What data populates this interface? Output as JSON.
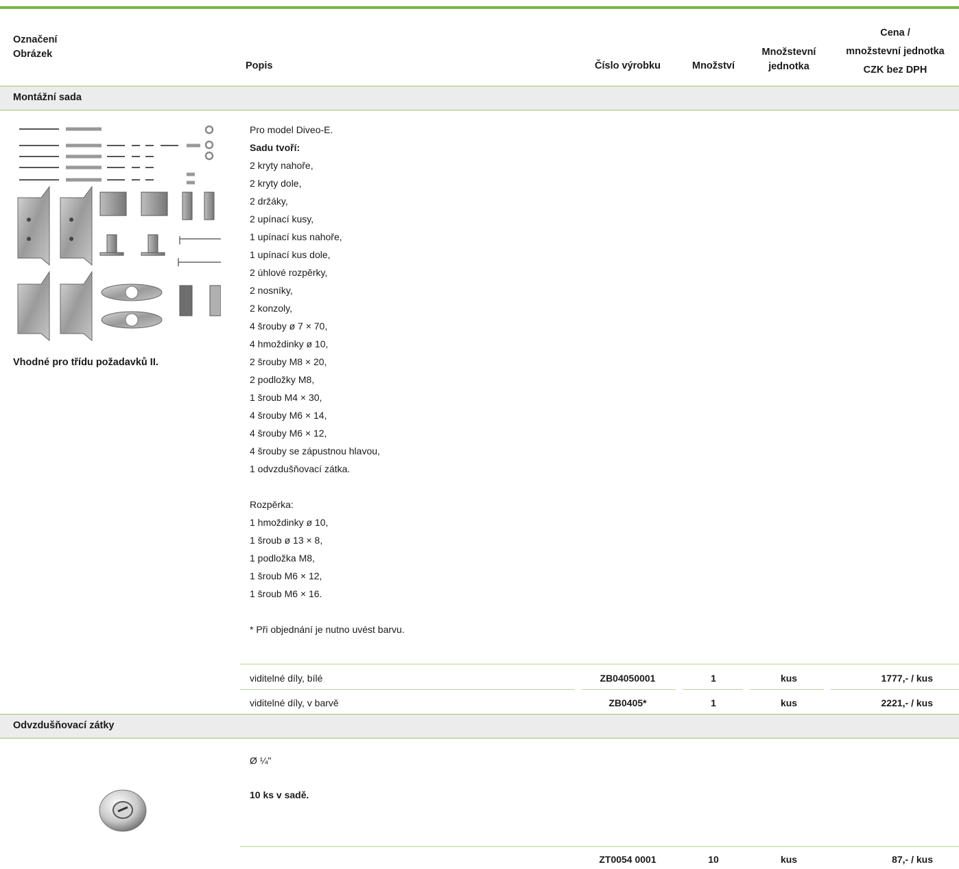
{
  "header": {
    "col1_line1": "Označení",
    "col1_line2": "Obrázek",
    "col2": "Popis",
    "col3": "Číslo výrobku",
    "col4": "Množství",
    "col5_line1": "Množstevní",
    "col5_line2": "jednotka",
    "col6_line1": "Cena /",
    "col6_line2": "množstevní jednotka",
    "col6_line3": "CZK bez DPH"
  },
  "sections": [
    {
      "title": "Montážní sada",
      "note": "Vhodné pro třídu požadavků II.",
      "desc_intro": "Pro model Diveo-E.",
      "desc_heading": "Sadu tvoří:",
      "items": [
        "2 kryty nahoře,",
        "2 kryty dole,",
        "2 držáky,",
        "2 upínací kusy,",
        "1 upínací kus nahoře,",
        "1 upínací kus dole,",
        "2 úhlové rozpěrky,",
        "2 nosníky,",
        "2 konzoly,",
        "4 šrouby ø 7 × 70,",
        "4 hmoždinky ø 10,",
        "2 šrouby M8 × 20,",
        "2 podložky M8,",
        "1 šroub M4 × 30,",
        "4 šrouby M6 × 14,",
        "4 šrouby M6 × 12,",
        "4 šrouby se zápustnou hlavou,",
        "1 odvzdušňovací zátka."
      ],
      "spacer_heading": "Rozpěrka:",
      "spacer_items": [
        "1 hmoždinky ø 10,",
        "1 šroub ø 13 × 8,",
        "1 podložka M8,",
        "1 šroub M6 × 12,",
        "1 šroub M6 × 16."
      ],
      "footnote": "* Při objednání je nutno uvést barvu.",
      "rows": [
        {
          "desc": "viditelné díly, bílé",
          "sku": "ZB04050001",
          "qty": "1",
          "unit": "kus",
          "price": "1777,- / kus"
        },
        {
          "desc": "viditelné díly, v barvě",
          "sku": "ZB0405*",
          "qty": "1",
          "unit": "kus",
          "price": "2221,- / kus"
        }
      ]
    },
    {
      "title": "Odvzdušňovací zátky",
      "desc_line1": "Ø ¼\"",
      "desc_line2": "10 ks v sadě.",
      "rows": [
        {
          "desc": "",
          "sku": "ZT0054 0001",
          "qty": "10",
          "unit": "kus",
          "price": "87,- / kus"
        }
      ]
    }
  ]
}
